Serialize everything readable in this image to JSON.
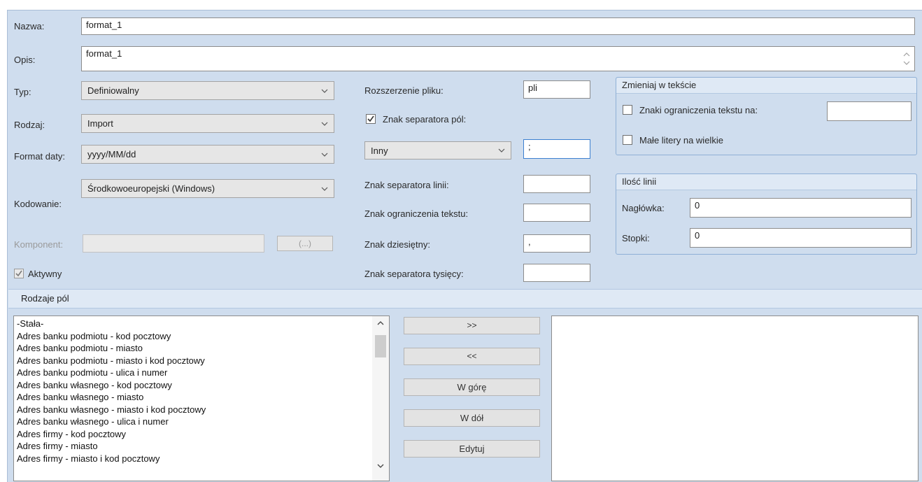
{
  "form": {
    "nazwa_label": "Nazwa:",
    "nazwa_value": "format_1",
    "opis_label": "Opis:",
    "opis_value": "format_1",
    "typ_label": "Typ:",
    "typ_value": "Definiowalny",
    "rodzaj_label": "Rodzaj:",
    "rodzaj_value": "Import",
    "format_daty_label": "Format daty:",
    "format_daty_value": "yyyy/MM/dd",
    "kodowanie_label": "Kodowanie:",
    "kodowanie_value": "Środkowoeuropejski (Windows)",
    "komponent_label": "Komponent:",
    "komponent_value": "",
    "komponent_button": "(...)",
    "aktywny_label": "Aktywny",
    "aktywny_checked": true
  },
  "file": {
    "rozszerzenie_label": "Rozszerzenie pliku:",
    "rozszerzenie_value": "pli",
    "separator_pol_label": "Znak separatora pól:",
    "separator_pol_checked": true,
    "separator_type_value": "Inny",
    "separator_char_value": ";",
    "separator_linii_label": "Znak separatora linii:",
    "separator_linii_value": "",
    "ograniczenia_label": "Znak ograniczenia tekstu:",
    "ograniczenia_value": "",
    "dziesietny_label": "Znak dziesiętny:",
    "dziesietny_value": ",",
    "tysiecy_label": "Znak separatora tysięcy:",
    "tysiecy_value": ""
  },
  "zmieniaj": {
    "title": "Zmieniaj w tekście",
    "znaki_label": "Znaki ograniczenia tekstu na:",
    "znaki_value": "",
    "male_label": "Małe litery na wielkie"
  },
  "ilosc": {
    "title": "Ilość linii",
    "naglowka_label": "Nagłówka:",
    "naglowka_value": "0",
    "stopki_label": "Stopki:",
    "stopki_value": "0"
  },
  "rodzaje": {
    "title": "Rodzaje pól",
    "items": [
      "-Stała-",
      "Adres banku podmiotu - kod pocztowy",
      "Adres banku podmiotu - miasto",
      "Adres banku podmiotu - miasto i kod pocztowy",
      "Adres banku podmiotu - ulica i numer",
      "Adres banku własnego - kod pocztowy",
      "Adres banku własnego - miasto",
      "Adres banku własnego - miasto i kod pocztowy",
      "Adres banku własnego - ulica i numer",
      "Adres firmy - kod pocztowy",
      "Adres firmy - miasto",
      "Adres firmy - miasto i kod pocztowy"
    ],
    "buttons": {
      "add": ">>",
      "remove": "<<",
      "up": "W górę",
      "down": "W dół",
      "edit": "Edytuj"
    }
  }
}
